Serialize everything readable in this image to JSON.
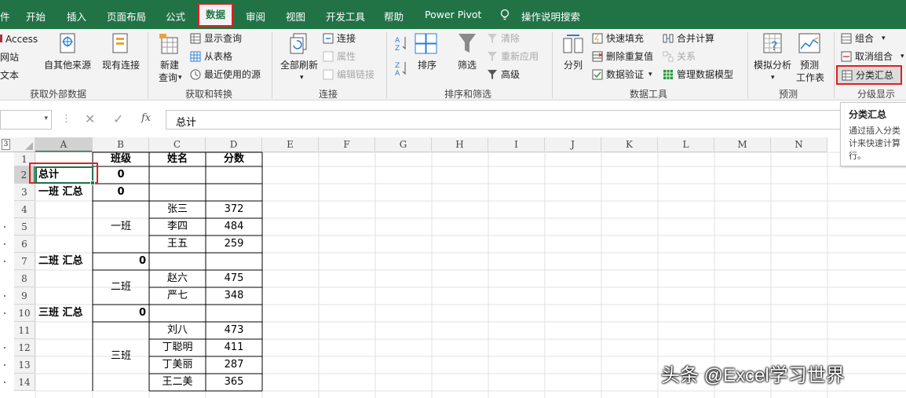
{
  "tabs": [
    "件",
    "开始",
    "插入",
    "页面布局",
    "公式",
    "数据",
    "审阅",
    "视图",
    "开发工具",
    "帮助",
    "Power Pivot",
    "操作说明搜索"
  ],
  "active_tab": "数据",
  "ribbon": {
    "get_external": {
      "items": [
        "Access",
        "网站",
        "文本"
      ],
      "other_sources": "自其他来源",
      "existing_conn": "现有连接",
      "label": "获取外部数据"
    },
    "get_transform": {
      "new_query_1": "新建",
      "new_query_2": "查询",
      "show_query": "显示查询",
      "from_table": "从表格",
      "recent_sources": "最近使用的源",
      "label": "获取和转换"
    },
    "connections": {
      "refresh_all": "全部刷新",
      "connections": "连接",
      "properties": "属性",
      "edit_links": "编辑链接",
      "label": "连接"
    },
    "sort_filter": {
      "sort": "排序",
      "filter": "筛选",
      "clear": "清除",
      "reapply": "重新应用",
      "advanced": "高级",
      "label": "排序和筛选"
    },
    "data_tools": {
      "split_col": "分列",
      "flash_fill": "快速填充",
      "remove_dup": "删除重复值",
      "validation": "数据验证",
      "consolidate": "合并计算",
      "relations": "关系",
      "data_model": "管理数据模型",
      "label": "数据工具"
    },
    "forecast": {
      "what_if": "模拟分析",
      "forecast_sheet_1": "预测",
      "forecast_sheet_2": "工作表",
      "label": "预测"
    },
    "outline": {
      "group": "组合",
      "ungroup": "取消组合",
      "subtotal": "分类汇总",
      "label": "分级显示"
    }
  },
  "formula_bar": {
    "fx": "fx",
    "content": "总计"
  },
  "outline_level": "3",
  "tooltip": {
    "title": "分类汇总",
    "body_1": "通过插入分类",
    "body_2": "计来快速计算",
    "body_3": "行。"
  },
  "columns": [
    "A",
    "B",
    "C",
    "D",
    "E",
    "F",
    "G",
    "H",
    "I",
    "J",
    "K",
    "L",
    "M",
    "N"
  ],
  "rows": [
    {
      "n": "1",
      "a": "",
      "b": "班级",
      "c": "姓名",
      "d": "分数"
    },
    {
      "n": "2",
      "a": "总计",
      "b": "0",
      "c": "",
      "d": ""
    },
    {
      "n": "3",
      "a": "一班 汇总",
      "b": "0",
      "c": "",
      "d": ""
    },
    {
      "n": "4",
      "a": "",
      "b": "",
      "c": "张三",
      "d": "372"
    },
    {
      "n": "5",
      "a": "",
      "b": "一班",
      "c": "李四",
      "d": "484"
    },
    {
      "n": "6",
      "a": "",
      "b": "",
      "c": "王五",
      "d": "259"
    },
    {
      "n": "7",
      "a": "二班 汇总",
      "b": "0",
      "c": "",
      "d": ""
    },
    {
      "n": "8",
      "a": "",
      "b": "二班",
      "c": "赵六",
      "d": "475"
    },
    {
      "n": "9",
      "a": "",
      "b": "",
      "c": "严七",
      "d": "348"
    },
    {
      "n": "10",
      "a": "三班 汇总",
      "b": "0",
      "c": "",
      "d": ""
    },
    {
      "n": "11",
      "a": "",
      "b": "",
      "c": "刘八",
      "d": "473"
    },
    {
      "n": "12",
      "a": "",
      "b": "三班",
      "c": "丁聪明",
      "d": "411"
    },
    {
      "n": "13",
      "a": "",
      "b": "",
      "c": "丁美丽",
      "d": "287"
    },
    {
      "n": "14",
      "a": "",
      "b": "",
      "c": "王二美",
      "d": "365"
    }
  ],
  "watermark": "头条 @Excel学习世界",
  "colors": {
    "ribbon_green": "#217346",
    "highlight_red": "#e02020"
  }
}
